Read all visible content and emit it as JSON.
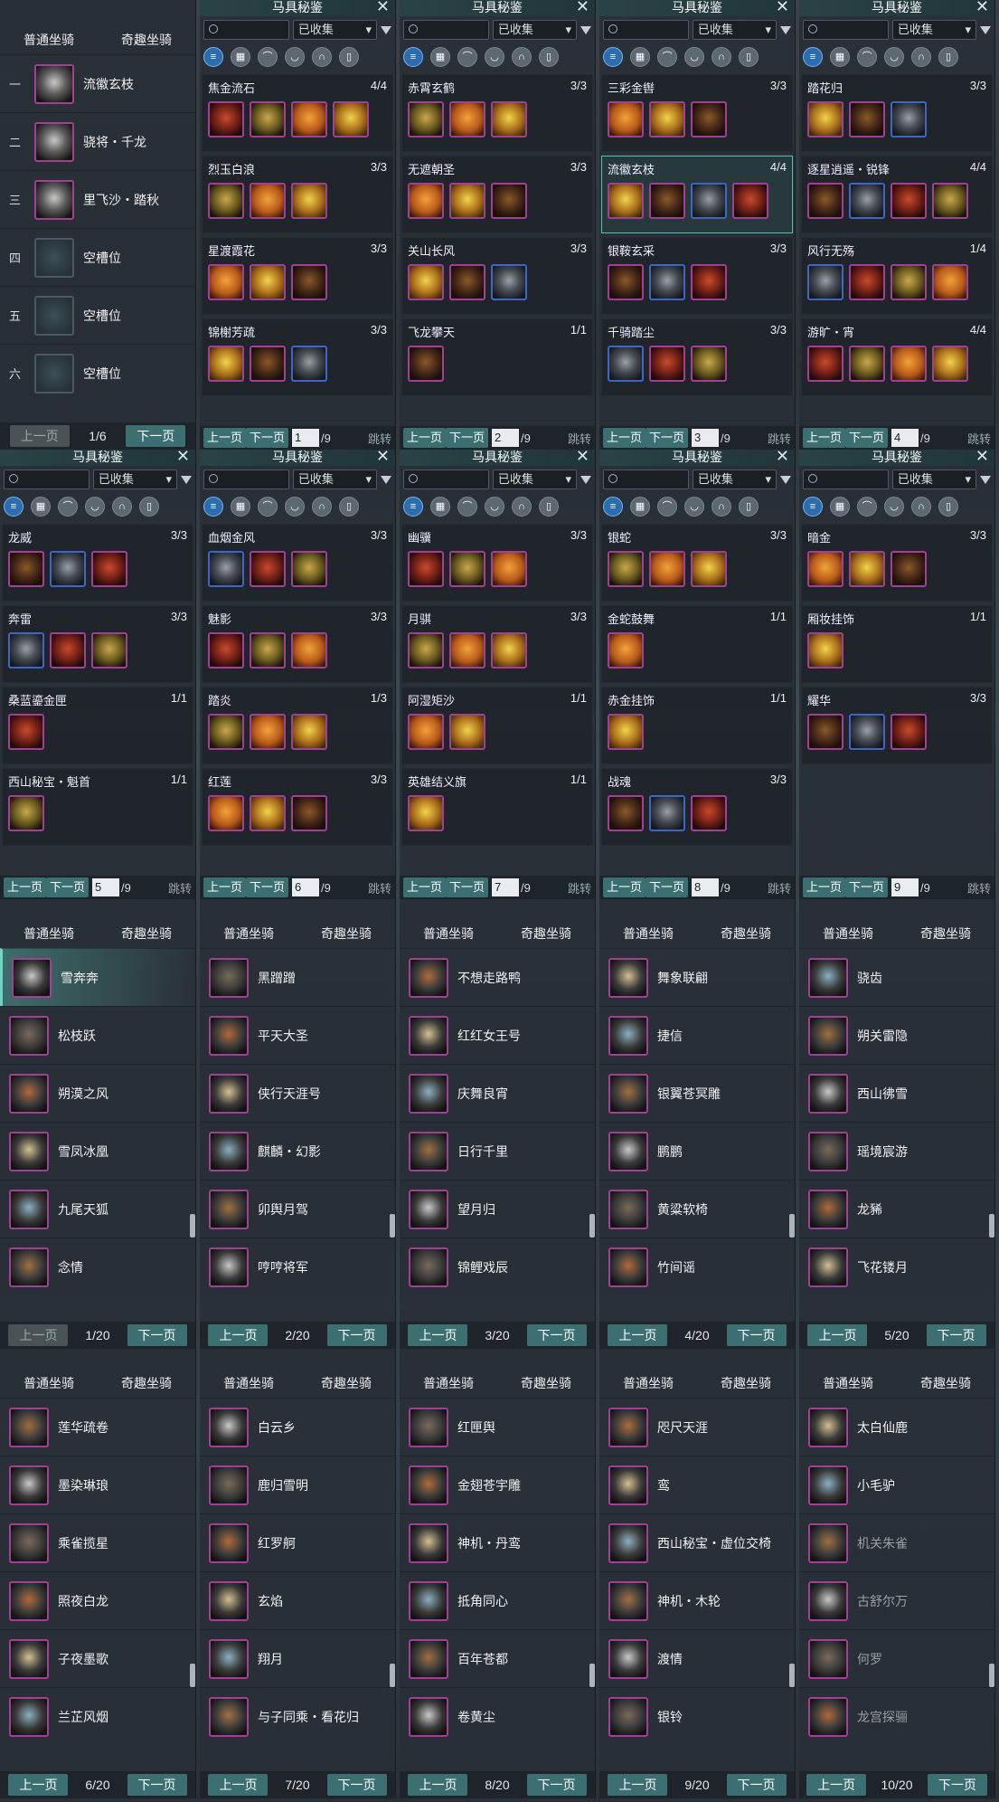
{
  "title": "马具秘鉴",
  "filter": "已收集",
  "prev": "上一页",
  "next": "下一页",
  "jump": "跳转",
  "tab_normal": "普通坐骑",
  "tab_fun": "奇趣坐骑",
  "slots": {
    "page": "1/6",
    "items": [
      {
        "num": "一",
        "name": "流徽玄枝"
      },
      {
        "num": "二",
        "name": "骁将・千龙"
      },
      {
        "num": "三",
        "name": "里飞沙・踏秋"
      },
      {
        "num": "四",
        "name": "空槽位"
      },
      {
        "num": "五",
        "name": "空槽位"
      },
      {
        "num": "六",
        "name": "空槽位"
      }
    ]
  },
  "gear_pages": [
    {
      "page": "1",
      "total": "/9",
      "entries": [
        {
          "n": "焦金流石",
          "c": "4/4",
          "k": 4,
          "s": true
        },
        {
          "n": "烈玉白浪",
          "c": "3/3",
          "k": 3
        },
        {
          "n": "星渡霞花",
          "c": "3/3",
          "k": 3
        },
        {
          "n": "锦榭芳疏",
          "c": "3/3",
          "k": 3
        }
      ]
    },
    {
      "page": "2",
      "total": "/9",
      "entries": [
        {
          "n": "赤霄玄鹤",
          "c": "3/3",
          "k": 3
        },
        {
          "n": "无遮朝圣",
          "c": "3/3",
          "k": 3
        },
        {
          "n": "关山长风",
          "c": "3/3",
          "k": 3
        },
        {
          "n": "飞龙攀天",
          "c": "1/1",
          "k": 1
        }
      ]
    },
    {
      "page": "3",
      "total": "/9",
      "entries": [
        {
          "n": "三彩金辔",
          "c": "3/3",
          "k": 3
        },
        {
          "n": "流徽玄枝",
          "c": "4/4",
          "k": 4,
          "s": true
        },
        {
          "n": "银鞍玄采",
          "c": "3/3",
          "k": 3
        },
        {
          "n": "千骑踏尘",
          "c": "3/3",
          "k": 3
        }
      ]
    },
    {
      "page": "4",
      "total": "/9",
      "entries": [
        {
          "n": "踏花归",
          "c": "3/3",
          "k": 3
        },
        {
          "n": "逐星逍遥・锐锋",
          "c": "4/4",
          "k": 4
        },
        {
          "n": "风行无殇",
          "c": "1/4",
          "k": 4
        },
        {
          "n": "游旷・宵",
          "c": "4/4",
          "k": 4
        }
      ]
    },
    {
      "page": "5",
      "total": "/9",
      "entries": [
        {
          "n": "龙威",
          "c": "3/3",
          "k": 3
        },
        {
          "n": "奔雷",
          "c": "3/3",
          "k": 3
        },
        {
          "n": "桑蓝鎏金匣",
          "c": "1/1",
          "k": 1
        },
        {
          "n": "西山秘宝・魁首",
          "c": "1/1",
          "k": 1
        }
      ]
    },
    {
      "page": "6",
      "total": "/9",
      "entries": [
        {
          "n": "血烟金风",
          "c": "3/3",
          "k": 3
        },
        {
          "n": "魅影",
          "c": "3/3",
          "k": 3
        },
        {
          "n": "踏炎",
          "c": "1/3",
          "k": 3
        },
        {
          "n": "红莲",
          "c": "3/3",
          "k": 3
        }
      ]
    },
    {
      "page": "7",
      "total": "/9",
      "entries": [
        {
          "n": "幽骥",
          "c": "3/3",
          "k": 3
        },
        {
          "n": "月骐",
          "c": "3/3",
          "k": 3
        },
        {
          "n": "阿湿矩沙",
          "c": "1/1",
          "k": 2
        },
        {
          "n": "英雄结义旗",
          "c": "1/1",
          "k": 1
        }
      ]
    },
    {
      "page": "8",
      "total": "/9",
      "entries": [
        {
          "n": "银蛇",
          "c": "3/3",
          "k": 3
        },
        {
          "n": "金蛇鼓舞",
          "c": "1/1",
          "k": 1
        },
        {
          "n": "赤金挂饰",
          "c": "1/1",
          "k": 1
        },
        {
          "n": "战魂",
          "c": "3/3",
          "k": 3
        }
      ]
    },
    {
      "page": "9",
      "total": "/9",
      "entries": [
        {
          "n": "暗金",
          "c": "3/3",
          "k": 3
        },
        {
          "n": "厢妆挂饰",
          "c": "1/1",
          "k": 1
        },
        {
          "n": "耀华",
          "c": "3/3",
          "k": 3
        }
      ]
    }
  ],
  "mount_pages": [
    {
      "page": "1/20",
      "items": [
        "雪奔奔",
        "松枝跃",
        "朔漠之风",
        "雪凤冰凰",
        "九尾天狐",
        "念情"
      ]
    },
    {
      "page": "2/20",
      "items": [
        "黑蹭蹭",
        "平天大圣",
        "侠行天涯号",
        "麒麟・幻影",
        "卯舆月驾",
        "哼哼将军"
      ]
    },
    {
      "page": "3/20",
      "items": [
        "不想走路鸭",
        "红红女王号",
        "庆舞良宵",
        "日行千里",
        "望月归",
        "锦鲤戏辰"
      ]
    },
    {
      "page": "4/20",
      "items": [
        "舞象联翩",
        "捷信",
        "银翼苍冥雕",
        "鹏鹏",
        "黄粱软椅",
        "竹间谣"
      ]
    },
    {
      "page": "5/20",
      "items": [
        "骁齿",
        "朔关雷隐",
        "西山彿雪",
        "瑶境宸游",
        "龙豨",
        "飞花镂月"
      ]
    },
    {
      "page": "6/20",
      "items": [
        "莲华疏卷",
        "墨染琳琅",
        "乘雀揽星",
        "照夜白龙",
        "子夜墨歌",
        "兰芷风烟"
      ]
    },
    {
      "page": "7/20",
      "items": [
        "白云乡",
        "鹿归雪明",
        "红罗舸",
        "玄焰",
        "翔月",
        "与子同乘・看花归"
      ]
    },
    {
      "page": "8/20",
      "items": [
        "红匣舆",
        "金翅苍宇雕",
        "神机・丹鸾",
        "抵角同心",
        "百年苍都",
        "卷黄尘"
      ]
    },
    {
      "page": "9/20",
      "items": [
        "咫尺天涯",
        "鸾",
        "西山秘宝・虚位交椅",
        "神机・木轮",
        "渡情",
        "银铃"
      ]
    },
    {
      "page": "10/20",
      "items": [
        "太白仙鹿",
        "小毛驴",
        "机关朱雀",
        "古舒尔万",
        "何罗",
        "龙宫探骊"
      ]
    }
  ]
}
